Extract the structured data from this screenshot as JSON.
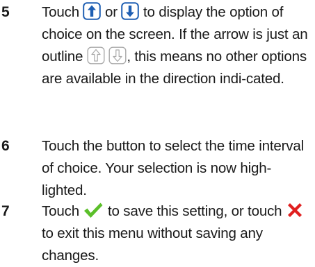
{
  "steps": [
    {
      "number": "5",
      "text_1": "Touch",
      "text_2": "or",
      "text_3": "to display the option of choice on the screen. If the arrow is just an outline",
      "text_4": ", this means no other options are available in the direction indi-cated."
    },
    {
      "number": "6",
      "text": "Touch the button to select the time interval of choice. Your selection is now high-lighted."
    },
    {
      "number": "7",
      "text_1": "Touch",
      "text_2": "to save this setting, or touch",
      "text_3": "to exit this menu without saving any changes."
    }
  ],
  "icons": {
    "up_arrow": "arrow-up-icon",
    "down_arrow": "arrow-down-icon",
    "up_arrow_outline": "arrow-up-outline-icon",
    "down_arrow_outline": "arrow-down-outline-icon",
    "check": "checkmark-icon",
    "cross": "cross-icon"
  },
  "colors": {
    "arrow_blue": "#1f5fb3",
    "outline_gray": "#aaaaaa",
    "check_green": "#5bbf2a",
    "cross_red": "#e02020"
  }
}
